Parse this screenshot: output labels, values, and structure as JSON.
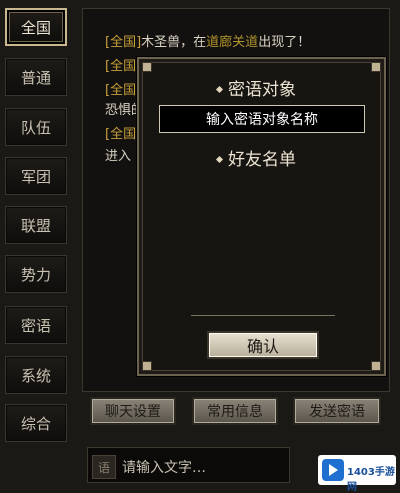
{
  "tabs": [
    {
      "label": "全国",
      "active": true
    },
    {
      "label": "普通"
    },
    {
      "label": "队伍"
    },
    {
      "label": "军团"
    },
    {
      "label": "联盟"
    },
    {
      "label": "势力"
    },
    {
      "label": "密语"
    },
    {
      "label": "系统"
    },
    {
      "label": "综合"
    }
  ],
  "chat": {
    "line1": {
      "tag": "[全国]",
      "text": "木圣兽，在",
      "place": "道廊关道",
      "tail": "出现了！"
    },
    "line2": {
      "tag": "[全国]"
    },
    "line3": {
      "tag": "[全国]"
    },
    "line4": {
      "text": "恐惧的"
    },
    "line5": {
      "tag": "[全国]"
    },
    "line6": {
      "text": "进入"
    }
  },
  "dialog": {
    "option_target": "密语对象",
    "target_input_placeholder": "输入密语对象名称",
    "option_friends": "好友名单",
    "confirm_label": "确认"
  },
  "buttons": {
    "chat_settings": "聊天设置",
    "common_messages": "常用信息",
    "send_whisper": "发送密语"
  },
  "input": {
    "mic_label": "语",
    "placeholder": "请输入文字…"
  },
  "watermark": {
    "text": "1403手游网"
  }
}
